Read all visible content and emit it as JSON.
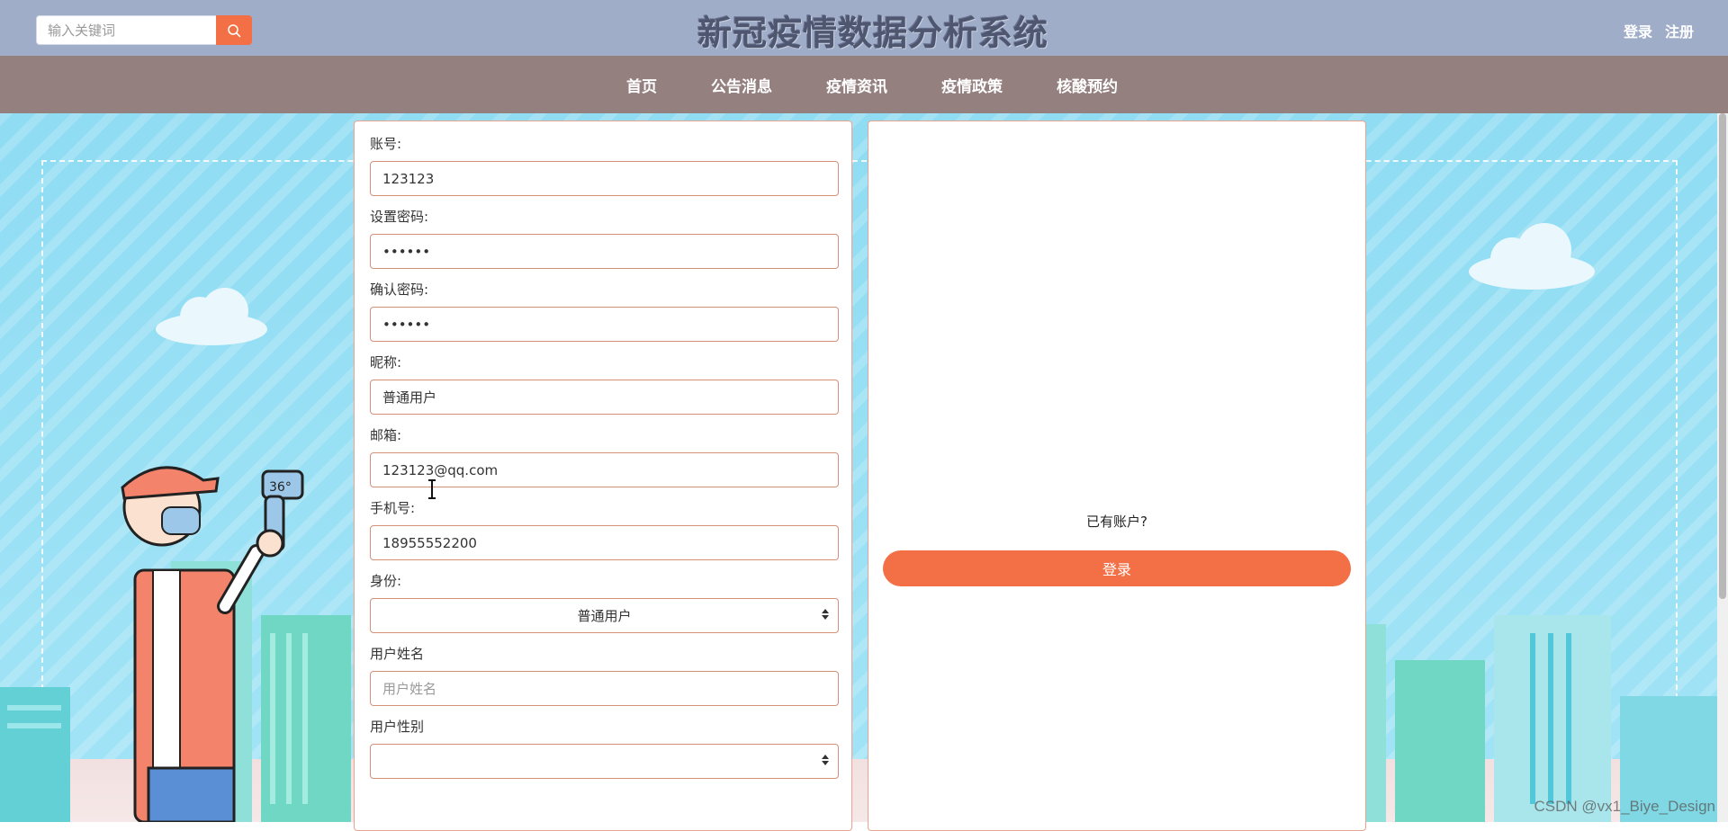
{
  "header": {
    "search_placeholder": "输入关键词",
    "site_title": "新冠疫情数据分析系统",
    "login_link": "登录",
    "register_link": "注册"
  },
  "nav": {
    "items": [
      {
        "label": "首页"
      },
      {
        "label": "公告消息"
      },
      {
        "label": "疫情资讯"
      },
      {
        "label": "疫情政策"
      },
      {
        "label": "核酸预约"
      }
    ]
  },
  "form": {
    "fields": [
      {
        "label": "账号:",
        "value": "123123"
      },
      {
        "label": "设置密码:",
        "value": "••••••"
      },
      {
        "label": "确认密码:",
        "value": "••••••"
      },
      {
        "label": "昵称:",
        "value": "普通用户"
      },
      {
        "label": "邮箱:",
        "value": "123123@qq.com"
      },
      {
        "label": "手机号:",
        "value": "18955552200"
      },
      {
        "label": "身份:",
        "value": "普通用户"
      },
      {
        "label": "用户姓名",
        "placeholder": "用户姓名"
      },
      {
        "label": "用户性别",
        "value": ""
      }
    ]
  },
  "login_panel": {
    "prompt": "已有账户?",
    "button_label": "登录"
  },
  "watermark": "CSDN @vx1_Biye_Design",
  "colors": {
    "header_bg": "#9fadc8",
    "nav_bg": "#958080",
    "accent": "#f36f45",
    "input_border": "#d4917a"
  }
}
